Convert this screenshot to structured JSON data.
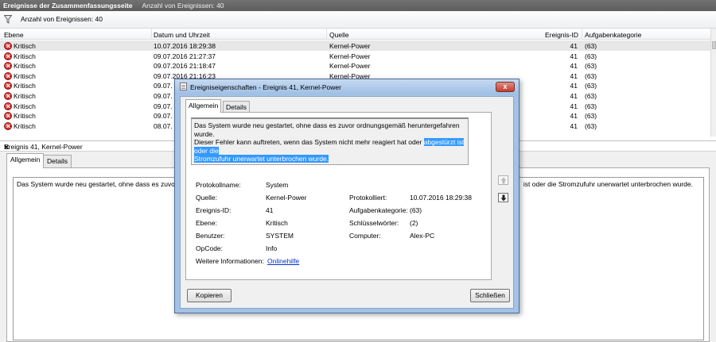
{
  "header": {
    "title": "Ereignisse der Zusammenfassungsseite",
    "subtitle": "Anzahl von Ereignissen: 40"
  },
  "filter": {
    "count_label": "Anzahl von Ereignissen: 40"
  },
  "table": {
    "columns": [
      "Ebene",
      "Datum und Uhrzeit",
      "Quelle",
      "Ereignis-ID",
      "Aufgabenkategorie"
    ],
    "rows": [
      {
        "level": "Kritisch",
        "date": "10.07.2016 18:29:38",
        "source": "Kernel-Power",
        "id": "41",
        "category": "(63)"
      },
      {
        "level": "Kritisch",
        "date": "09.07.2016 21:27:37",
        "source": "Kernel-Power",
        "id": "41",
        "category": "(63)"
      },
      {
        "level": "Kritisch",
        "date": "09.07.2016 21:18:47",
        "source": "Kernel-Power",
        "id": "41",
        "category": "(63)"
      },
      {
        "level": "Kritisch",
        "date": "09.07.2016 21:16:23",
        "source": "Kernel-Power",
        "id": "41",
        "category": "(63)"
      },
      {
        "level": "Kritisch",
        "date": "09.07.",
        "source": "",
        "id": "41",
        "category": "(63)"
      },
      {
        "level": "Kritisch",
        "date": "09.07.",
        "source": "",
        "id": "41",
        "category": "(63)"
      },
      {
        "level": "Kritisch",
        "date": "09.07.",
        "source": "",
        "id": "41",
        "category": "(63)"
      },
      {
        "level": "Kritisch",
        "date": "09.07.",
        "source": "",
        "id": "41",
        "category": "(63)"
      },
      {
        "level": "Kritisch",
        "date": "08.07.",
        "source": "",
        "id": "41",
        "category": "(63)"
      }
    ]
  },
  "detail_pane": {
    "title": "Ereignis 41, Kernel-Power",
    "tabs": [
      "Allgemein",
      "Details"
    ],
    "text_left": "Das System wurde neu gestartet, ohne dass es zuvor ordn",
    "text_right": "ist oder die Stromzufuhr unerwartet unterbrochen wurde."
  },
  "dialog": {
    "title": "Ereigniseigenschaften - Ereignis 41, Kernel-Power",
    "tabs": [
      "Allgemein",
      "Details"
    ],
    "message_line1": "Das System wurde neu gestartet, ohne dass es zuvor ordnungsgemäß heruntergefahren wurde.",
    "message_line2_plain": "Dieser Fehler kann auftreten, wenn das System nicht mehr reagiert hat oder ",
    "message_line2_selected": "abgestürzt ist oder die",
    "message_line3_selected": "Stromzufuhr unerwartet unterbrochen wurde.",
    "fields": {
      "log_name_label": "Protokollname:",
      "log_name": "System",
      "source_label": "Quelle:",
      "source": "Kernel-Power",
      "logged_label": "Protokolliert:",
      "logged": "10.07.2016 18:29:38",
      "event_id_label": "Ereignis-ID:",
      "event_id": "41",
      "task_cat_label": "Aufgabenkategorie:",
      "task_cat": "(63)",
      "level_label": "Ebene:",
      "level": "Kritisch",
      "keywords_label": "Schlüsselwörter:",
      "keywords": "(2)",
      "user_label": "Benutzer:",
      "user": "SYSTEM",
      "computer_label": "Computer:",
      "computer": "Alex-PC",
      "opcode_label": "OpCode:",
      "opcode": "Info",
      "more_info_label": "Weitere Informationen:",
      "more_info_link": "Onlinehilfe"
    },
    "buttons": {
      "copy": "Kopieren",
      "close": "Schließen"
    },
    "close_glyph": "x"
  },
  "pane_close_glyph": "×"
}
